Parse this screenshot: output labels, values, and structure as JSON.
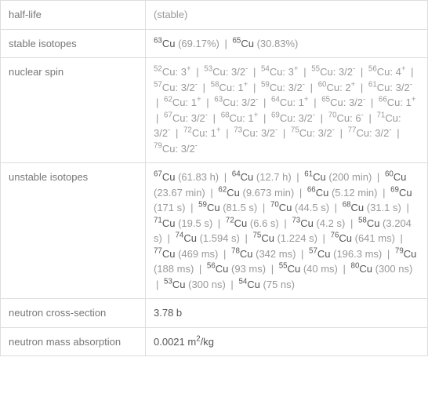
{
  "rows": [
    {
      "label": "half-life",
      "value_html": "(stable)"
    },
    {
      "label": "stable isotopes",
      "value_html": "<span class='dark'><sup>63</sup>Cu</span> (69.17%) <span class='pipe'>|</span> <span class='dark'><sup>65</sup>Cu</span> (30.83%)"
    },
    {
      "label": "nuclear spin",
      "value_html": "<sup>52</sup>Cu: 3<sup>+</sup> <span class='pipe'>|</span> <sup>53</sup>Cu: 3/2<sup>-</sup> <span class='pipe'>|</span> <sup>54</sup>Cu: 3<sup>+</sup> <span class='pipe'>|</span> <sup>55</sup>Cu: 3/2<sup>-</sup> <span class='pipe'>|</span> <sup>56</sup>Cu: 4<sup>+</sup> <span class='pipe'>|</span> <sup>57</sup>Cu: 3/2<sup>-</sup> <span class='pipe'>|</span> <sup>58</sup>Cu: 1<sup>+</sup> <span class='pipe'>|</span> <sup>59</sup>Cu: 3/2<sup>-</sup> <span class='pipe'>|</span> <sup>60</sup>Cu: 2<sup>+</sup> <span class='pipe'>|</span> <sup>61</sup>Cu: 3/2<sup>-</sup> <span class='pipe'>|</span> <sup>62</sup>Cu: 1<sup>+</sup> <span class='pipe'>|</span> <sup>63</sup>Cu: 3/2<sup>-</sup> <span class='pipe'>|</span> <sup>64</sup>Cu: 1<sup>+</sup> <span class='pipe'>|</span> <sup>65</sup>Cu: 3/2<sup>-</sup> <span class='pipe'>|</span> <sup>66</sup>Cu: 1<sup>+</sup> <span class='pipe'>|</span> <sup>67</sup>Cu: 3/2<sup>-</sup> <span class='pipe'>|</span> <sup>68</sup>Cu: 1<sup>+</sup> <span class='pipe'>|</span> <sup>69</sup>Cu: 3/2<sup>-</sup> <span class='pipe'>|</span> <sup>70</sup>Cu: 6<sup>-</sup> <span class='pipe'>|</span> <sup>71</sup>Cu: 3/2<sup>-</sup> <span class='pipe'>|</span> <sup>72</sup>Cu: 1<sup>+</sup> <span class='pipe'>|</span> <sup>73</sup>Cu: 3/2<sup>-</sup> <span class='pipe'>|</span> <sup>75</sup>Cu: 3/2<sup>-</sup> <span class='pipe'>|</span> <sup>77</sup>Cu: 3/2<sup>-</sup> <span class='pipe'>|</span> <sup>79</sup>Cu: 3/2<sup>-</sup>"
    },
    {
      "label": "unstable isotopes",
      "value_html": "<span class='dark'><sup>67</sup>Cu</span> (61.83 h) <span class='pipe'>|</span> <span class='dark'><sup>64</sup>Cu</span> (12.7 h) <span class='pipe'>|</span> <span class='dark'><sup>61</sup>Cu</span> (200 min) <span class='pipe'>|</span> <span class='dark'><sup>60</sup>Cu</span> (23.67 min) <span class='pipe'>|</span> <span class='dark'><sup>62</sup>Cu</span> (9.673 min) <span class='pipe'>|</span> <span class='dark'><sup>66</sup>Cu</span> (5.12 min) <span class='pipe'>|</span> <span class='dark'><sup>69</sup>Cu</span> (171 s) <span class='pipe'>|</span> <span class='dark'><sup>59</sup>Cu</span> (81.5 s) <span class='pipe'>|</span> <span class='dark'><sup>70</sup>Cu</span> (44.5 s) <span class='pipe'>|</span> <span class='dark'><sup>68</sup>Cu</span> (31.1 s) <span class='pipe'>|</span> <span class='dark'><sup>71</sup>Cu</span> (19.5 s) <span class='pipe'>|</span> <span class='dark'><sup>72</sup>Cu</span> (6.6 s) <span class='pipe'>|</span> <span class='dark'><sup>73</sup>Cu</span> (4.2 s) <span class='pipe'>|</span> <span class='dark'><sup>58</sup>Cu</span> (3.204 s) <span class='pipe'>|</span> <span class='dark'><sup>74</sup>Cu</span> (1.594 s) <span class='pipe'>|</span> <span class='dark'><sup>75</sup>Cu</span> (1.224 s) <span class='pipe'>|</span> <span class='dark'><sup>76</sup>Cu</span> (641 ms) <span class='pipe'>|</span> <span class='dark'><sup>77</sup>Cu</span> (469 ms) <span class='pipe'>|</span> <span class='dark'><sup>78</sup>Cu</span> (342 ms) <span class='pipe'>|</span> <span class='dark'><sup>57</sup>Cu</span> (196.3 ms) <span class='pipe'>|</span> <span class='dark'><sup>79</sup>Cu</span> (188 ms) <span class='pipe'>|</span> <span class='dark'><sup>56</sup>Cu</span> (93 ms) <span class='pipe'>|</span> <span class='dark'><sup>55</sup>Cu</span> (40 ms) <span class='pipe'>|</span> <span class='dark'><sup>80</sup>Cu</span> (300 ns) <span class='pipe'>|</span> <span class='dark'><sup>53</sup>Cu</span> (300 ns) <span class='pipe'>|</span> <span class='dark'><sup>54</sup>Cu</span> (75 ns)"
    },
    {
      "label": "neutron cross-section",
      "value_html": "<span class='dark'>3.78 b</span>"
    },
    {
      "label": "neutron mass absorption",
      "value_html": "<span class='dark'>0.0021 m<sup>2</sup>/kg</span>"
    }
  ]
}
